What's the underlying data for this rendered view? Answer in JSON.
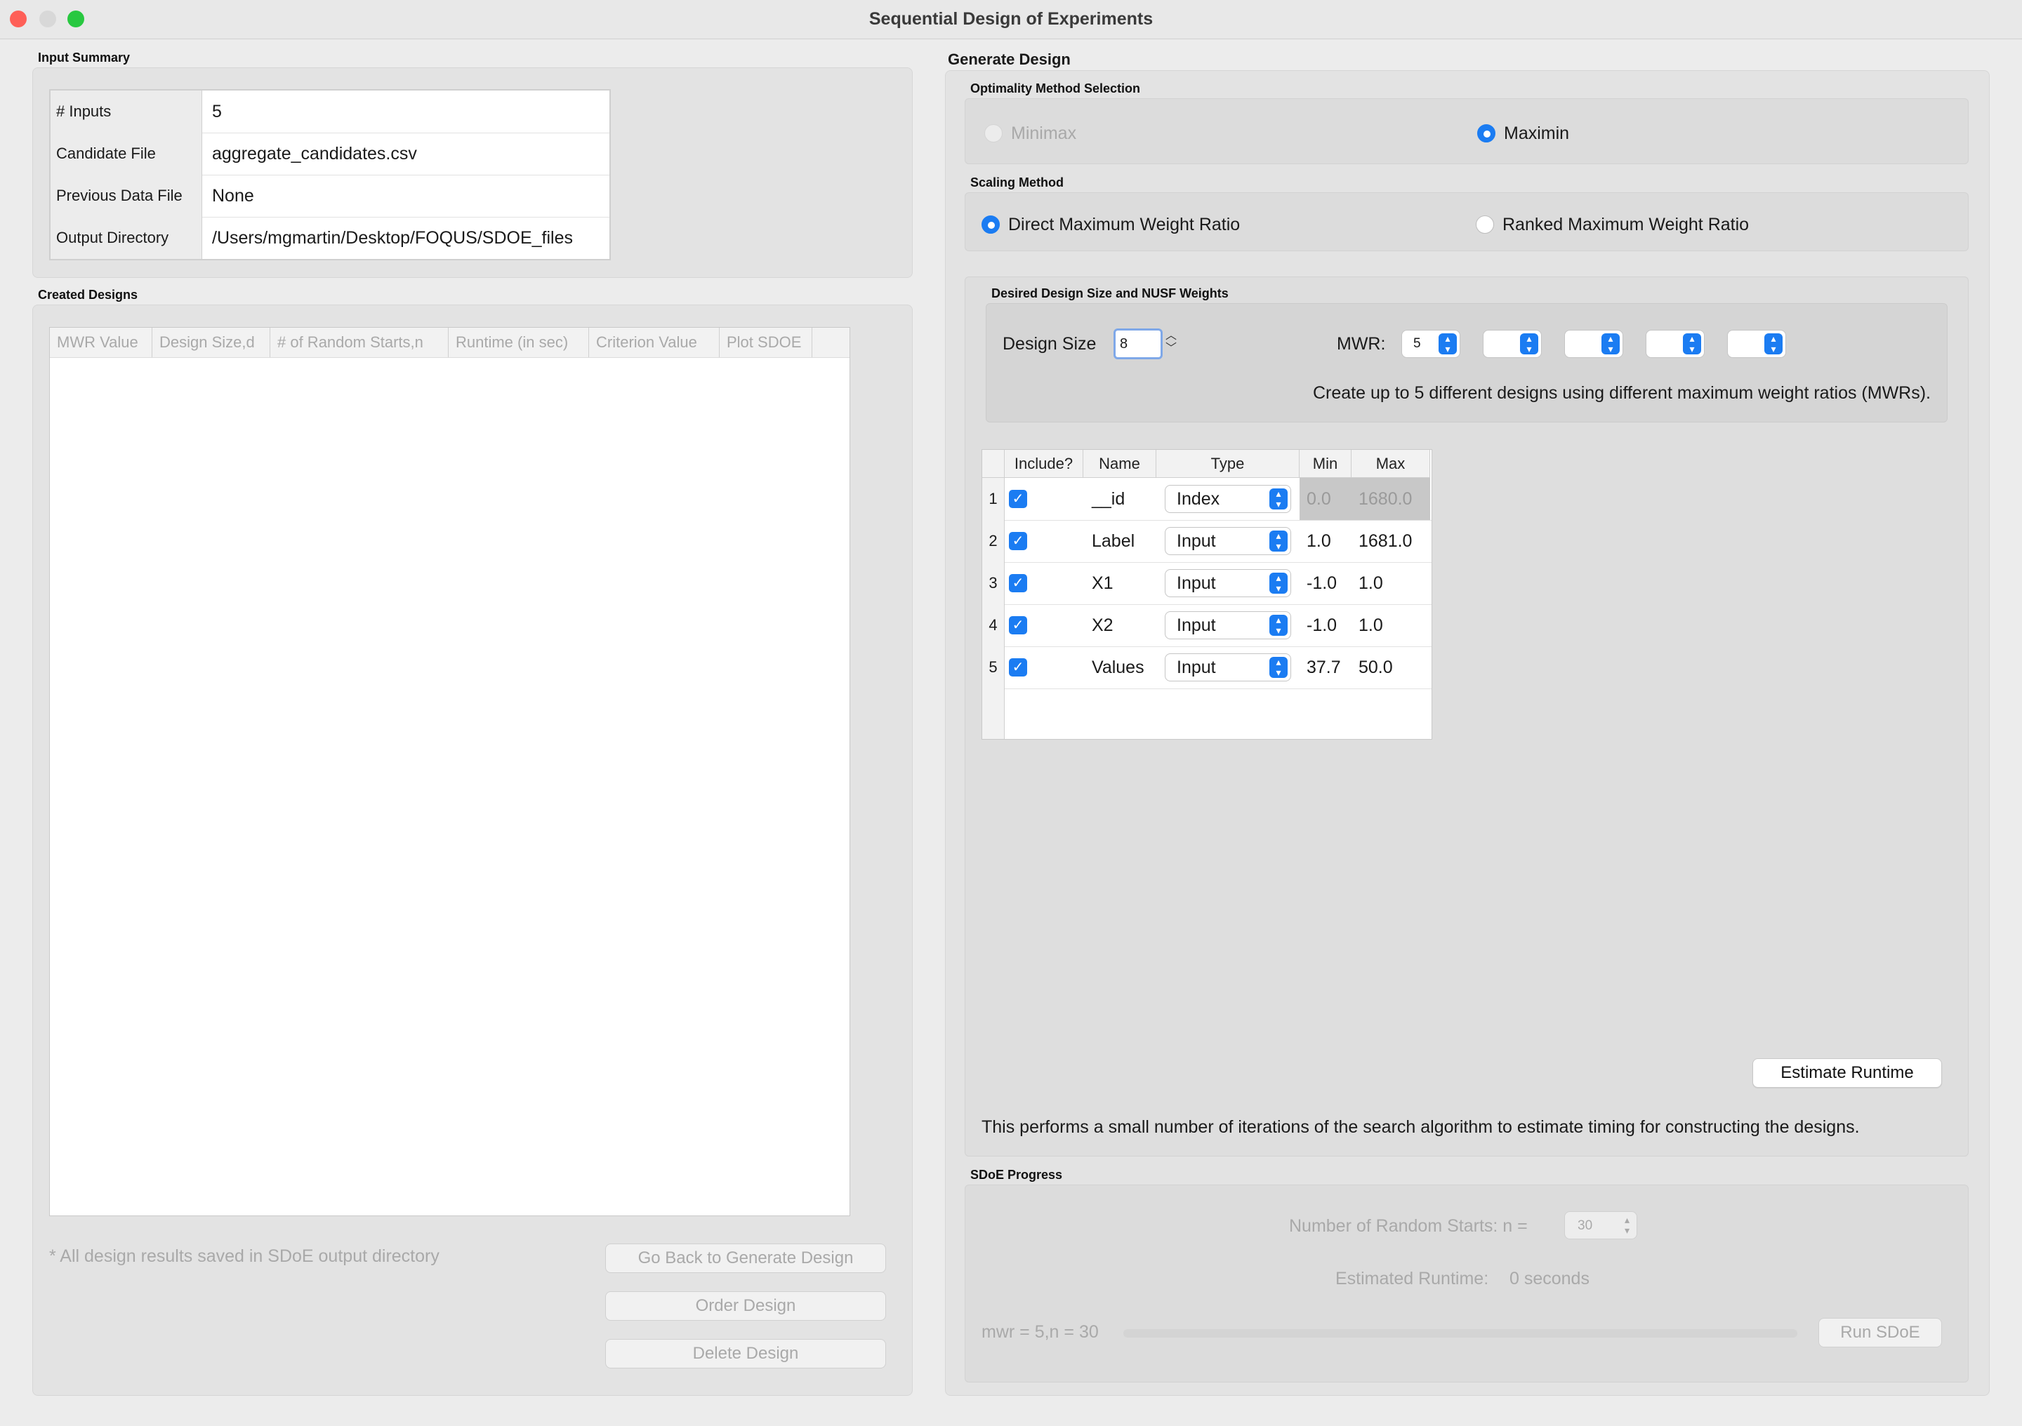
{
  "window": {
    "title": "Sequential Design of Experiments"
  },
  "input_summary": {
    "title": "Input Summary",
    "rows": [
      {
        "key": "# Inputs",
        "value": "5"
      },
      {
        "key": "Candidate File",
        "value": "aggregate_candidates.csv"
      },
      {
        "key": "Previous Data File",
        "value": "None"
      },
      {
        "key": "Output Directory",
        "value": "/Users/mgmartin/Desktop/FOQUS/SDOE_files"
      }
    ]
  },
  "created_designs": {
    "title": "Created Designs",
    "columns": [
      "MWR Value",
      "Design Size,d",
      "# of Random Starts,n",
      "Runtime (in sec)",
      "Criterion Value",
      "Plot SDOE"
    ],
    "note": "* All design results saved in SDoE output directory",
    "buttons": {
      "go_back": "Go Back to Generate Design",
      "order": "Order Design",
      "delete": "Delete Design"
    }
  },
  "generate_design": {
    "title": "Generate Design",
    "optimality": {
      "title": "Optimality Method Selection",
      "minimax": "Minimax",
      "maximin": "Maximin",
      "selected": "Maximin"
    },
    "scaling": {
      "title": "Scaling Method",
      "direct": "Direct Maximum Weight Ratio",
      "ranked": "Ranked Maximum Weight Ratio",
      "selected": "Direct Maximum Weight Ratio"
    },
    "nusf": {
      "title": "Desired Design Size and NUSF Weights",
      "design_size_label": "Design Size",
      "design_size_value": "8",
      "mwr_label": "MWR:",
      "mwr_values": [
        "5",
        "",
        "",
        "",
        ""
      ],
      "help": "Create up to 5 different designs using different maximum weight ratios (MWRs)."
    },
    "variables": {
      "columns": [
        "Include?",
        "Name",
        "Type",
        "Min",
        "Max"
      ],
      "rows": [
        {
          "num": "1",
          "include": true,
          "name": "__id",
          "type": "Index",
          "min": "0.0",
          "max": "1680.0"
        },
        {
          "num": "2",
          "include": true,
          "name": "Label",
          "type": "Input",
          "min": "1.0",
          "max": "1681.0"
        },
        {
          "num": "3",
          "include": true,
          "name": "X1",
          "type": "Input",
          "min": "-1.0",
          "max": "1.0"
        },
        {
          "num": "4",
          "include": true,
          "name": "X2",
          "type": "Input",
          "min": "-1.0",
          "max": "1.0"
        },
        {
          "num": "5",
          "include": true,
          "name": "Values",
          "type": "Input",
          "min": "37.7",
          "max": "50.0"
        }
      ]
    },
    "estimate_button": "Estimate Runtime",
    "estimate_help": "This performs a small number of iterations of the search algorithm to estimate timing for constructing the designs."
  },
  "progress": {
    "title": "SDoE Progress",
    "random_starts_label": "Number of Random Starts: n =",
    "random_starts_value": "30",
    "runtime_label": "Estimated Runtime:",
    "runtime_value": "0 seconds",
    "status": "mwr = 5,n = 30",
    "progress_fraction": 0,
    "run_button": "Run SDoE"
  },
  "colors": {
    "accent": "#1b7cf2",
    "close": "#fe5f57",
    "minimize": "#d8d8d8",
    "zoom": "#28c840"
  }
}
